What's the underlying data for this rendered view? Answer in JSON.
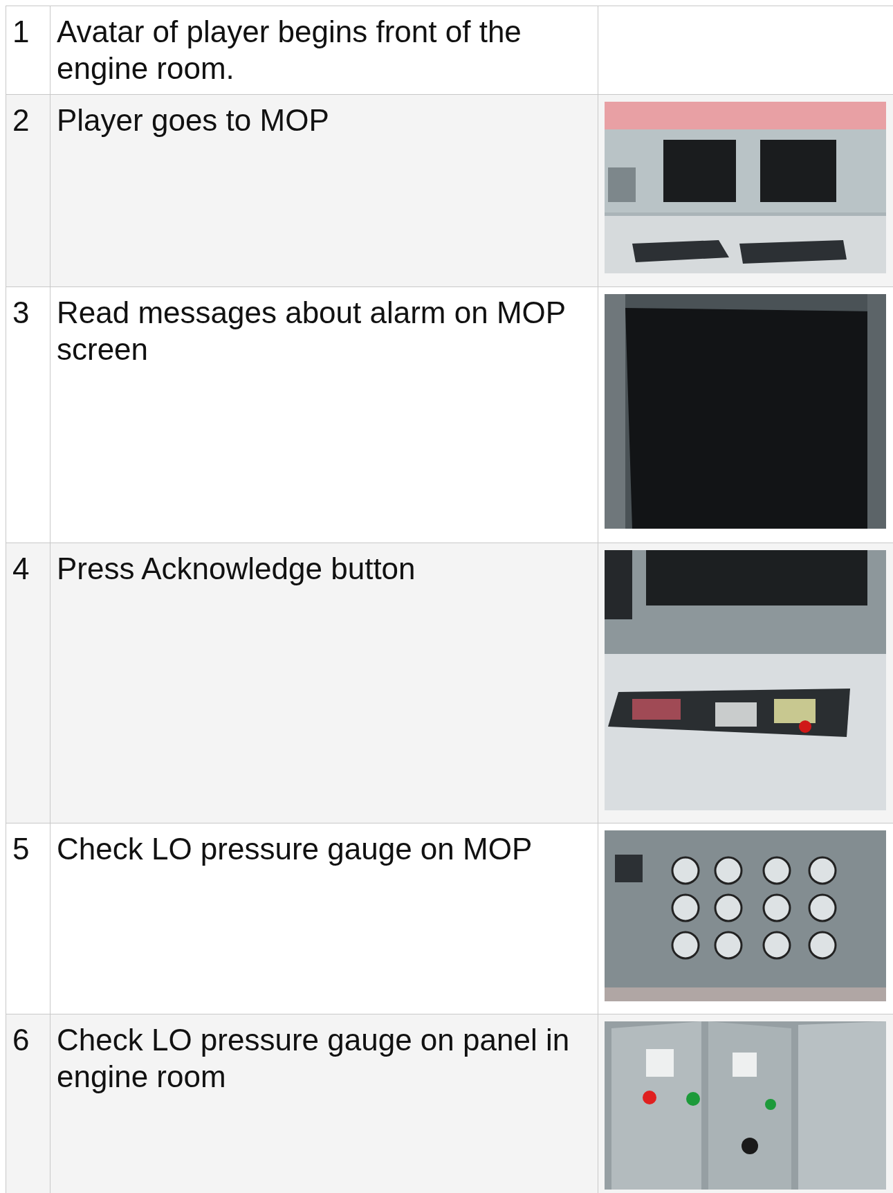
{
  "table": {
    "rows": [
      {
        "number": "1",
        "text": "Avatar of player begins front of the engine room."
      },
      {
        "number": "2",
        "text": "Player goes to MOP"
      },
      {
        "number": "3",
        "text": "Read messages about alarm on MOP screen"
      },
      {
        "number": "4",
        "text": "Press Acknowledge button"
      },
      {
        "number": "5",
        "text": "Check LO pressure gauge on MOP"
      },
      {
        "number": "6",
        "text": "Check LO pressure gauge on panel in engine room"
      }
    ]
  }
}
